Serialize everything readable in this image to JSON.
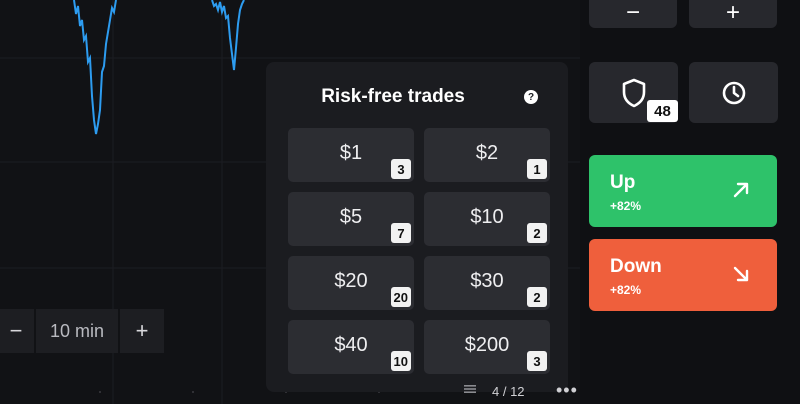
{
  "chart": {
    "timeframe": {
      "minus_label": "−",
      "value": "10 min",
      "plus_label": "+"
    }
  },
  "risk_free": {
    "title": "Risk-free trades",
    "help_label": "?",
    "amounts": [
      {
        "label": "$1",
        "count": "3"
      },
      {
        "label": "$2",
        "count": "1"
      },
      {
        "label": "$5",
        "count": "7"
      },
      {
        "label": "$10",
        "count": "2"
      },
      {
        "label": "$20",
        "count": "20"
      },
      {
        "label": "$30",
        "count": "2"
      },
      {
        "label": "$40",
        "count": "10"
      },
      {
        "label": "$200",
        "count": "3"
      }
    ],
    "pager": "4 / 12",
    "more_label": "•••"
  },
  "controls": {
    "minus_label": "−",
    "plus_label": "+",
    "shield_count": "48"
  },
  "trade": {
    "up": {
      "label": "Up",
      "payout": "+82%",
      "color": "#2ec26a"
    },
    "down": {
      "label": "Down",
      "payout": "+82%",
      "color": "#ef5f3c"
    }
  },
  "colors": {
    "line": "#2d9cf0",
    "panel": "#1b1c20",
    "button": "#2c2d32"
  }
}
